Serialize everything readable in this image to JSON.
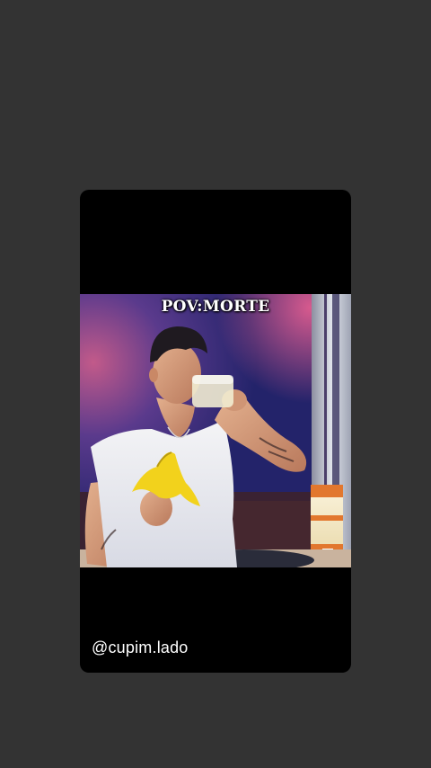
{
  "story": {
    "caption": "POV:MORTE",
    "username": "@cupim.lado"
  },
  "colors": {
    "background": "#333333",
    "card": "#000000",
    "text": "#ffffff"
  },
  "icons": {
    "video": "video-thumbnail"
  }
}
